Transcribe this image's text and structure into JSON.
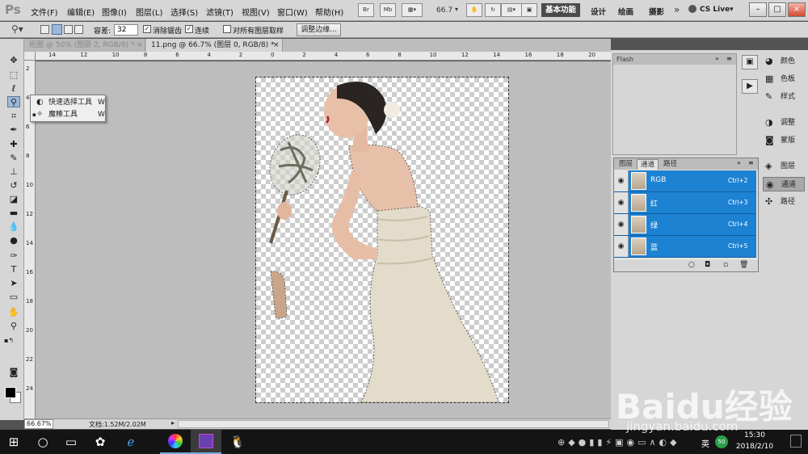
{
  "app": {
    "logo": "Ps",
    "menus": [
      "文件(F)",
      "编辑(E)",
      "图像(I)",
      "图层(L)",
      "选择(S)",
      "滤镜(T)",
      "视图(V)",
      "窗口(W)",
      "帮助(H)"
    ],
    "menubar_buttons": [
      "Br",
      "Mb"
    ],
    "zoom_value": "66.7",
    "workspaces": {
      "active": "基本功能",
      "others": [
        "设计",
        "绘画",
        "摄影"
      ]
    },
    "overflow": "»",
    "cs_live": "CS Live▾",
    "window_buttons": [
      "–",
      "□",
      "×"
    ]
  },
  "options": {
    "tolerance_label": "容差:",
    "tolerance_value": "32",
    "anti_alias": "消除锯齿",
    "contiguous": "连续",
    "sample_all": "对所有图层取样",
    "refine_edge": "调整边缘..."
  },
  "tabs": [
    {
      "label": "拒图 @ 50% (图层 2, RGB/8) *",
      "close": "×"
    },
    {
      "label": "11.png @ 66.7% (图层 0, RGB/8) *",
      "close": "×"
    }
  ],
  "ruler": {
    "top": [
      "14",
      "12",
      "10",
      "8",
      "6",
      "4",
      "2",
      "0",
      "2",
      "4",
      "6",
      "8",
      "10",
      "12",
      "14",
      "16",
      "18",
      "20",
      "22"
    ],
    "left": [
      "2",
      "4",
      "6",
      "8",
      "10",
      "12",
      "14",
      "16",
      "18",
      "20",
      "22",
      "24"
    ]
  },
  "flyout": {
    "items": [
      {
        "label": "快速选择工具",
        "key": "W",
        "icon": "quick-selection-icon"
      },
      {
        "label": "魔棒工具",
        "key": "W",
        "icon": "magic-wand-icon"
      }
    ]
  },
  "status": {
    "zoom": "66.67%",
    "doc_size": "文档:1.52M/2.02M"
  },
  "flash_panel": {
    "title": "Flash"
  },
  "panel_group": [
    {
      "label": "颜色",
      "icon": "color-icon"
    },
    {
      "label": "色板",
      "icon": "swatches-icon"
    },
    {
      "label": "样式",
      "icon": "styles-icon"
    },
    {
      "label": "调整",
      "icon": "adjustments-icon"
    },
    {
      "label": "蒙版",
      "icon": "masks-icon"
    },
    {
      "label": "图层",
      "icon": "layers-icon"
    },
    {
      "label": "通道",
      "icon": "channels-icon"
    },
    {
      "label": "路径",
      "icon": "paths-icon"
    }
  ],
  "channels_panel": {
    "tabs": [
      "图层",
      "通道",
      "路径"
    ],
    "active_tab": "通道",
    "rows": [
      {
        "name": "RGB",
        "shortcut": "Ctrl+2"
      },
      {
        "name": "红",
        "shortcut": "Ctrl+3"
      },
      {
        "name": "绿",
        "shortcut": "Ctrl+4"
      },
      {
        "name": "蓝",
        "shortcut": "Ctrl+5"
      }
    ],
    "selected_color": "#1e82d2"
  },
  "taskbar": {
    "language": "英",
    "temperature": "50",
    "time": "15:30",
    "date": "2018/2/10"
  },
  "watermark": {
    "main": "Baidu经验",
    "sub": "jingyan.baidu.com"
  }
}
